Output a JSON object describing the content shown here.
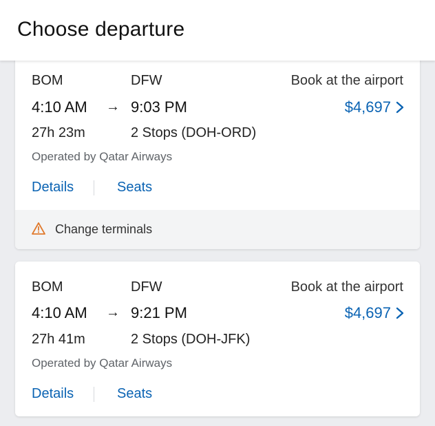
{
  "header": {
    "title": "Choose departure"
  },
  "flights": [
    {
      "origin": "BOM",
      "destination": "DFW",
      "depart_time": "4:10 AM",
      "arrive_time": "9:03 PM",
      "arrow": "→",
      "duration": "27h 23m",
      "stops": "2 Stops (DOH-ORD)",
      "operator": "Operated by Qatar Airways",
      "booking_note": "Book at the airport",
      "price": "$4,697",
      "details_label": "Details",
      "seats_label": "Seats",
      "alert": {
        "icon": "warning-triangle-icon",
        "text": "Change terminals",
        "color": "#e07a2d"
      }
    },
    {
      "origin": "BOM",
      "destination": "DFW",
      "depart_time": "4:10 AM",
      "arrive_time": "9:21 PM",
      "arrow": "→",
      "duration": "27h 41m",
      "stops": "2 Stops (DOH-JFK)",
      "operator": "Operated by Qatar Airways",
      "booking_note": "Book at the airport",
      "price": "$4,697",
      "details_label": "Details",
      "seats_label": "Seats"
    }
  ],
  "colors": {
    "link": "#0a63b3",
    "warning": "#e07a2d",
    "background": "#ecedf0"
  }
}
